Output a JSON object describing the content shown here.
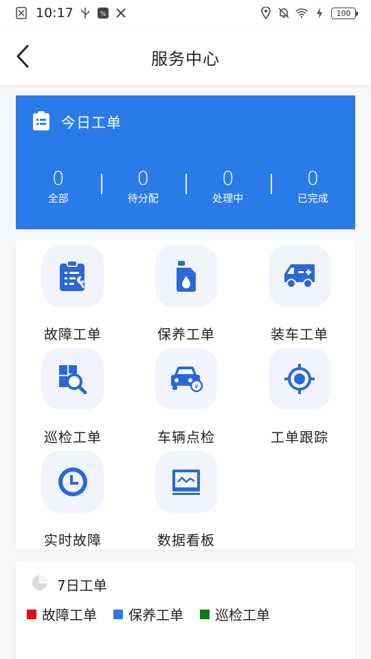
{
  "status_bar": {
    "time": "10:17",
    "battery": "100"
  },
  "header": {
    "title": "服务中心"
  },
  "today": {
    "title": "今日工单",
    "stats": [
      {
        "value": "0",
        "label": "全部"
      },
      {
        "value": "0",
        "label": "待分配"
      },
      {
        "value": "0",
        "label": "处理中"
      },
      {
        "value": "0",
        "label": "已完成"
      }
    ]
  },
  "grid": {
    "items": [
      {
        "label": "故障工单",
        "icon": "clipboard-wrench-icon"
      },
      {
        "label": "保养工单",
        "icon": "oil-can-icon"
      },
      {
        "label": "装车工单",
        "icon": "truck-plus-icon"
      },
      {
        "label": "巡检工单",
        "icon": "inspect-magnifier-icon"
      },
      {
        "label": "车辆点检",
        "icon": "car-check-icon"
      },
      {
        "label": "工单跟踪",
        "icon": "target-icon"
      },
      {
        "label": "实时故障",
        "icon": "clock-icon"
      },
      {
        "label": "数据看板",
        "icon": "chart-board-icon"
      }
    ]
  },
  "week": {
    "title": "7日工单",
    "legend": [
      {
        "label": "故障工单",
        "color": "#e30b0b"
      },
      {
        "label": "保养工单",
        "color": "#2a7ae9"
      },
      {
        "label": "巡检工单",
        "color": "#0c7a14"
      }
    ]
  },
  "colors": {
    "primary": "#2a7ae9",
    "icon_bg": "#f1f4fb"
  }
}
